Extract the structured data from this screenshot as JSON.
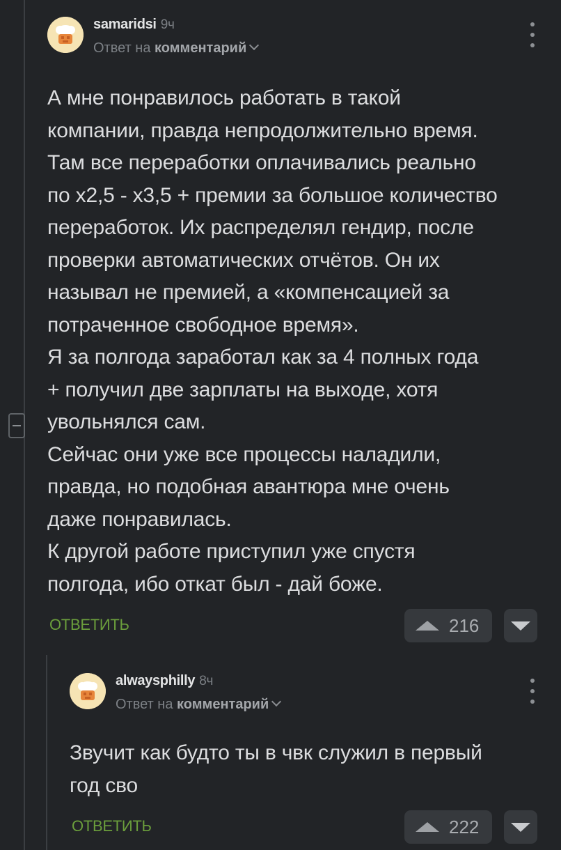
{
  "comments": [
    {
      "username": "samaridsi",
      "time": "9ч",
      "reply_prefix": "Ответ на",
      "reply_target": "комментарий",
      "body": "А мне понравилось работать в такой\nкомпании, правда непродолжительно время.\nТам все переработки оплачивались реально\nпо х2,5 - х3,5 + премии за большое количество\nпереработок. Их распределял гендир, после\nпроверки автоматических отчётов. Он их\nназывал не премией, а «компенсацией за\nпотраченное свободное время».\nЯ за полгода заработал как за 4 полных года\n+ получил две зарплаты на выходе, хотя\nувольнялся сам.\nСейчас они уже все процессы наладили,\nправда, но подобная авантюра мне очень\nдаже понравилась.\nК другой работе приступил уже спустя\nполгода, ибо откат был - дай боже.",
      "reply_label": "ОТВЕТИТЬ",
      "rating": "216"
    },
    {
      "username": "alwaysphilly",
      "time": "8ч",
      "reply_prefix": "Ответ на",
      "reply_target": "комментарий",
      "body": "Звучит как будто ты в чвк служил в первый\nгод сво",
      "reply_label": "ОТВЕТИТЬ",
      "rating": "222"
    }
  ],
  "icons": {
    "avatar": "chef-hat-avatar-icon",
    "more": "vertical-dots-icon",
    "upvote": "triangle-up-icon",
    "downvote": "triangle-down-icon",
    "collapse": "minus-icon"
  },
  "colors": {
    "background": "#222427",
    "reply_action": "#6b9e3c",
    "text": "#dcdddf",
    "meta": "#7c8085",
    "vote_bg": "#36393d"
  }
}
